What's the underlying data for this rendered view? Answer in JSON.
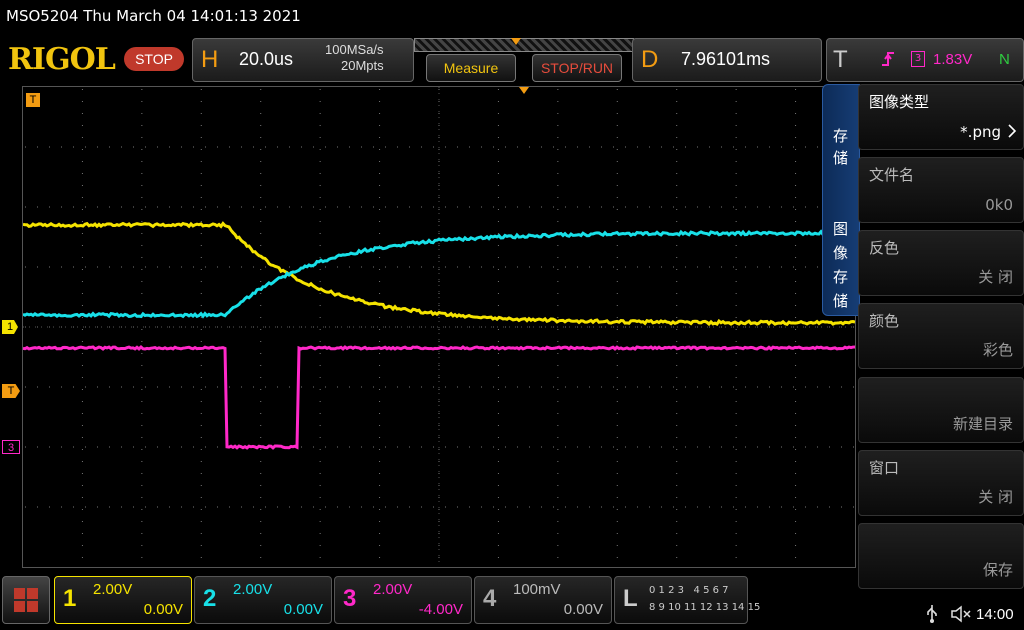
{
  "title_bar": "MSO5204  Thu March 04 14:01:13 2021",
  "logo": "RIGOL",
  "run_state": "STOP",
  "horizontal": {
    "letter": "H",
    "timebase": "20.0us",
    "sample_rate": "100MSa/s",
    "memory_depth": "20Mpts"
  },
  "buttons": {
    "measure": "Measure",
    "stop_run": "STOP/RUN"
  },
  "delay": {
    "letter": "D",
    "value": "7.96101ms"
  },
  "trigger": {
    "letter": "T",
    "channel_symbol": "3",
    "level": "1.83V",
    "mode": "N"
  },
  "markers": {
    "trigger_top": "T",
    "ch1": "1",
    "ch_t": "T",
    "ch3": "3"
  },
  "side_tabs": {
    "save": "存储",
    "image_save": "图像存储"
  },
  "menu": [
    {
      "label": "图像类型",
      "value": "*.png"
    },
    {
      "label": "文件名",
      "value": "0k0"
    },
    {
      "label": "反色",
      "value": "关 闭"
    },
    {
      "label": "颜色",
      "value": "彩色"
    },
    {
      "label": "",
      "value": "新建目录"
    },
    {
      "label": "窗口",
      "value": "关 闭"
    },
    {
      "label": "",
      "value": "保存"
    }
  ],
  "channels": [
    {
      "num": "1",
      "scale": "2.00V",
      "offset": "0.00V",
      "color": "#f5e300"
    },
    {
      "num": "2",
      "scale": "2.00V",
      "offset": "0.00V",
      "color": "#18e0e8"
    },
    {
      "num": "3",
      "scale": "2.00V",
      "offset": "-4.00V",
      "color": "#ff28c8"
    },
    {
      "num": "4",
      "scale": "100mV",
      "offset": "0.00V",
      "color": "#aaaaaa"
    }
  ],
  "logic": {
    "letter": "L",
    "row1": "0 1 2 3   4 5 6 7",
    "row2": "8 9 10 11 12 13 14 15"
  },
  "clock": "14:00",
  "colors": {
    "ch1": "#f5e300",
    "ch2": "#18e0e8",
    "ch3": "#ff28c8",
    "accent": "#f39c12",
    "stop": "#c0392b"
  }
}
